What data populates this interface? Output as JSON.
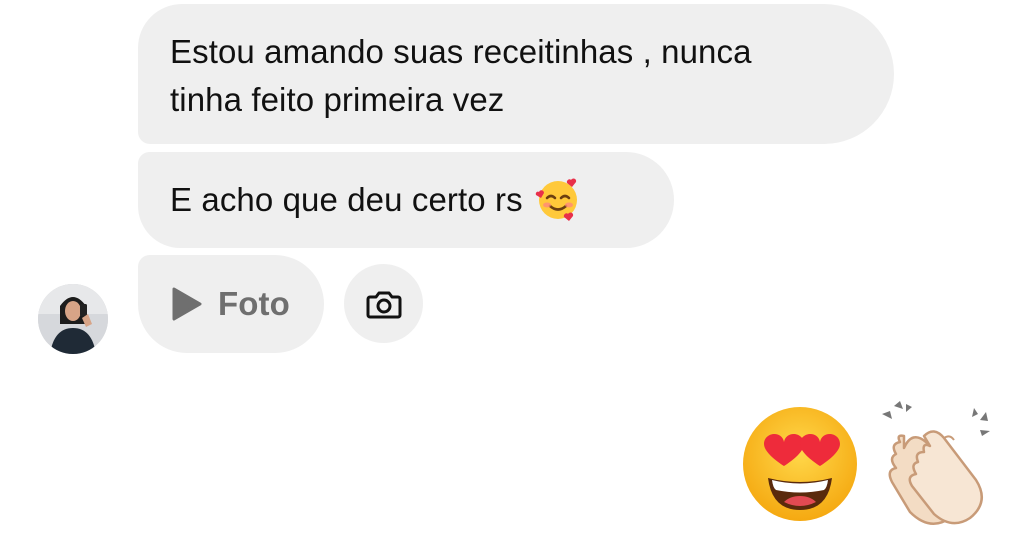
{
  "messages": [
    {
      "line1": "Estou amando suas receitinhas , nunca",
      "line2": "tinha feito primeira vez"
    },
    {
      "text": "E acho que deu certo rs",
      "emoji": "smiling-face-with-hearts-icon"
    }
  ],
  "attachment": {
    "label": "Foto",
    "icon": "play-icon"
  },
  "camera": {
    "icon": "camera-icon"
  },
  "avatar": {
    "icon": "profile-photo"
  },
  "reactions": [
    "heart-eyes-emoji",
    "clapping-hands-emoji"
  ],
  "colors": {
    "bubble": "#efefef",
    "text": "#111111",
    "muted": "#6f6f6f"
  }
}
